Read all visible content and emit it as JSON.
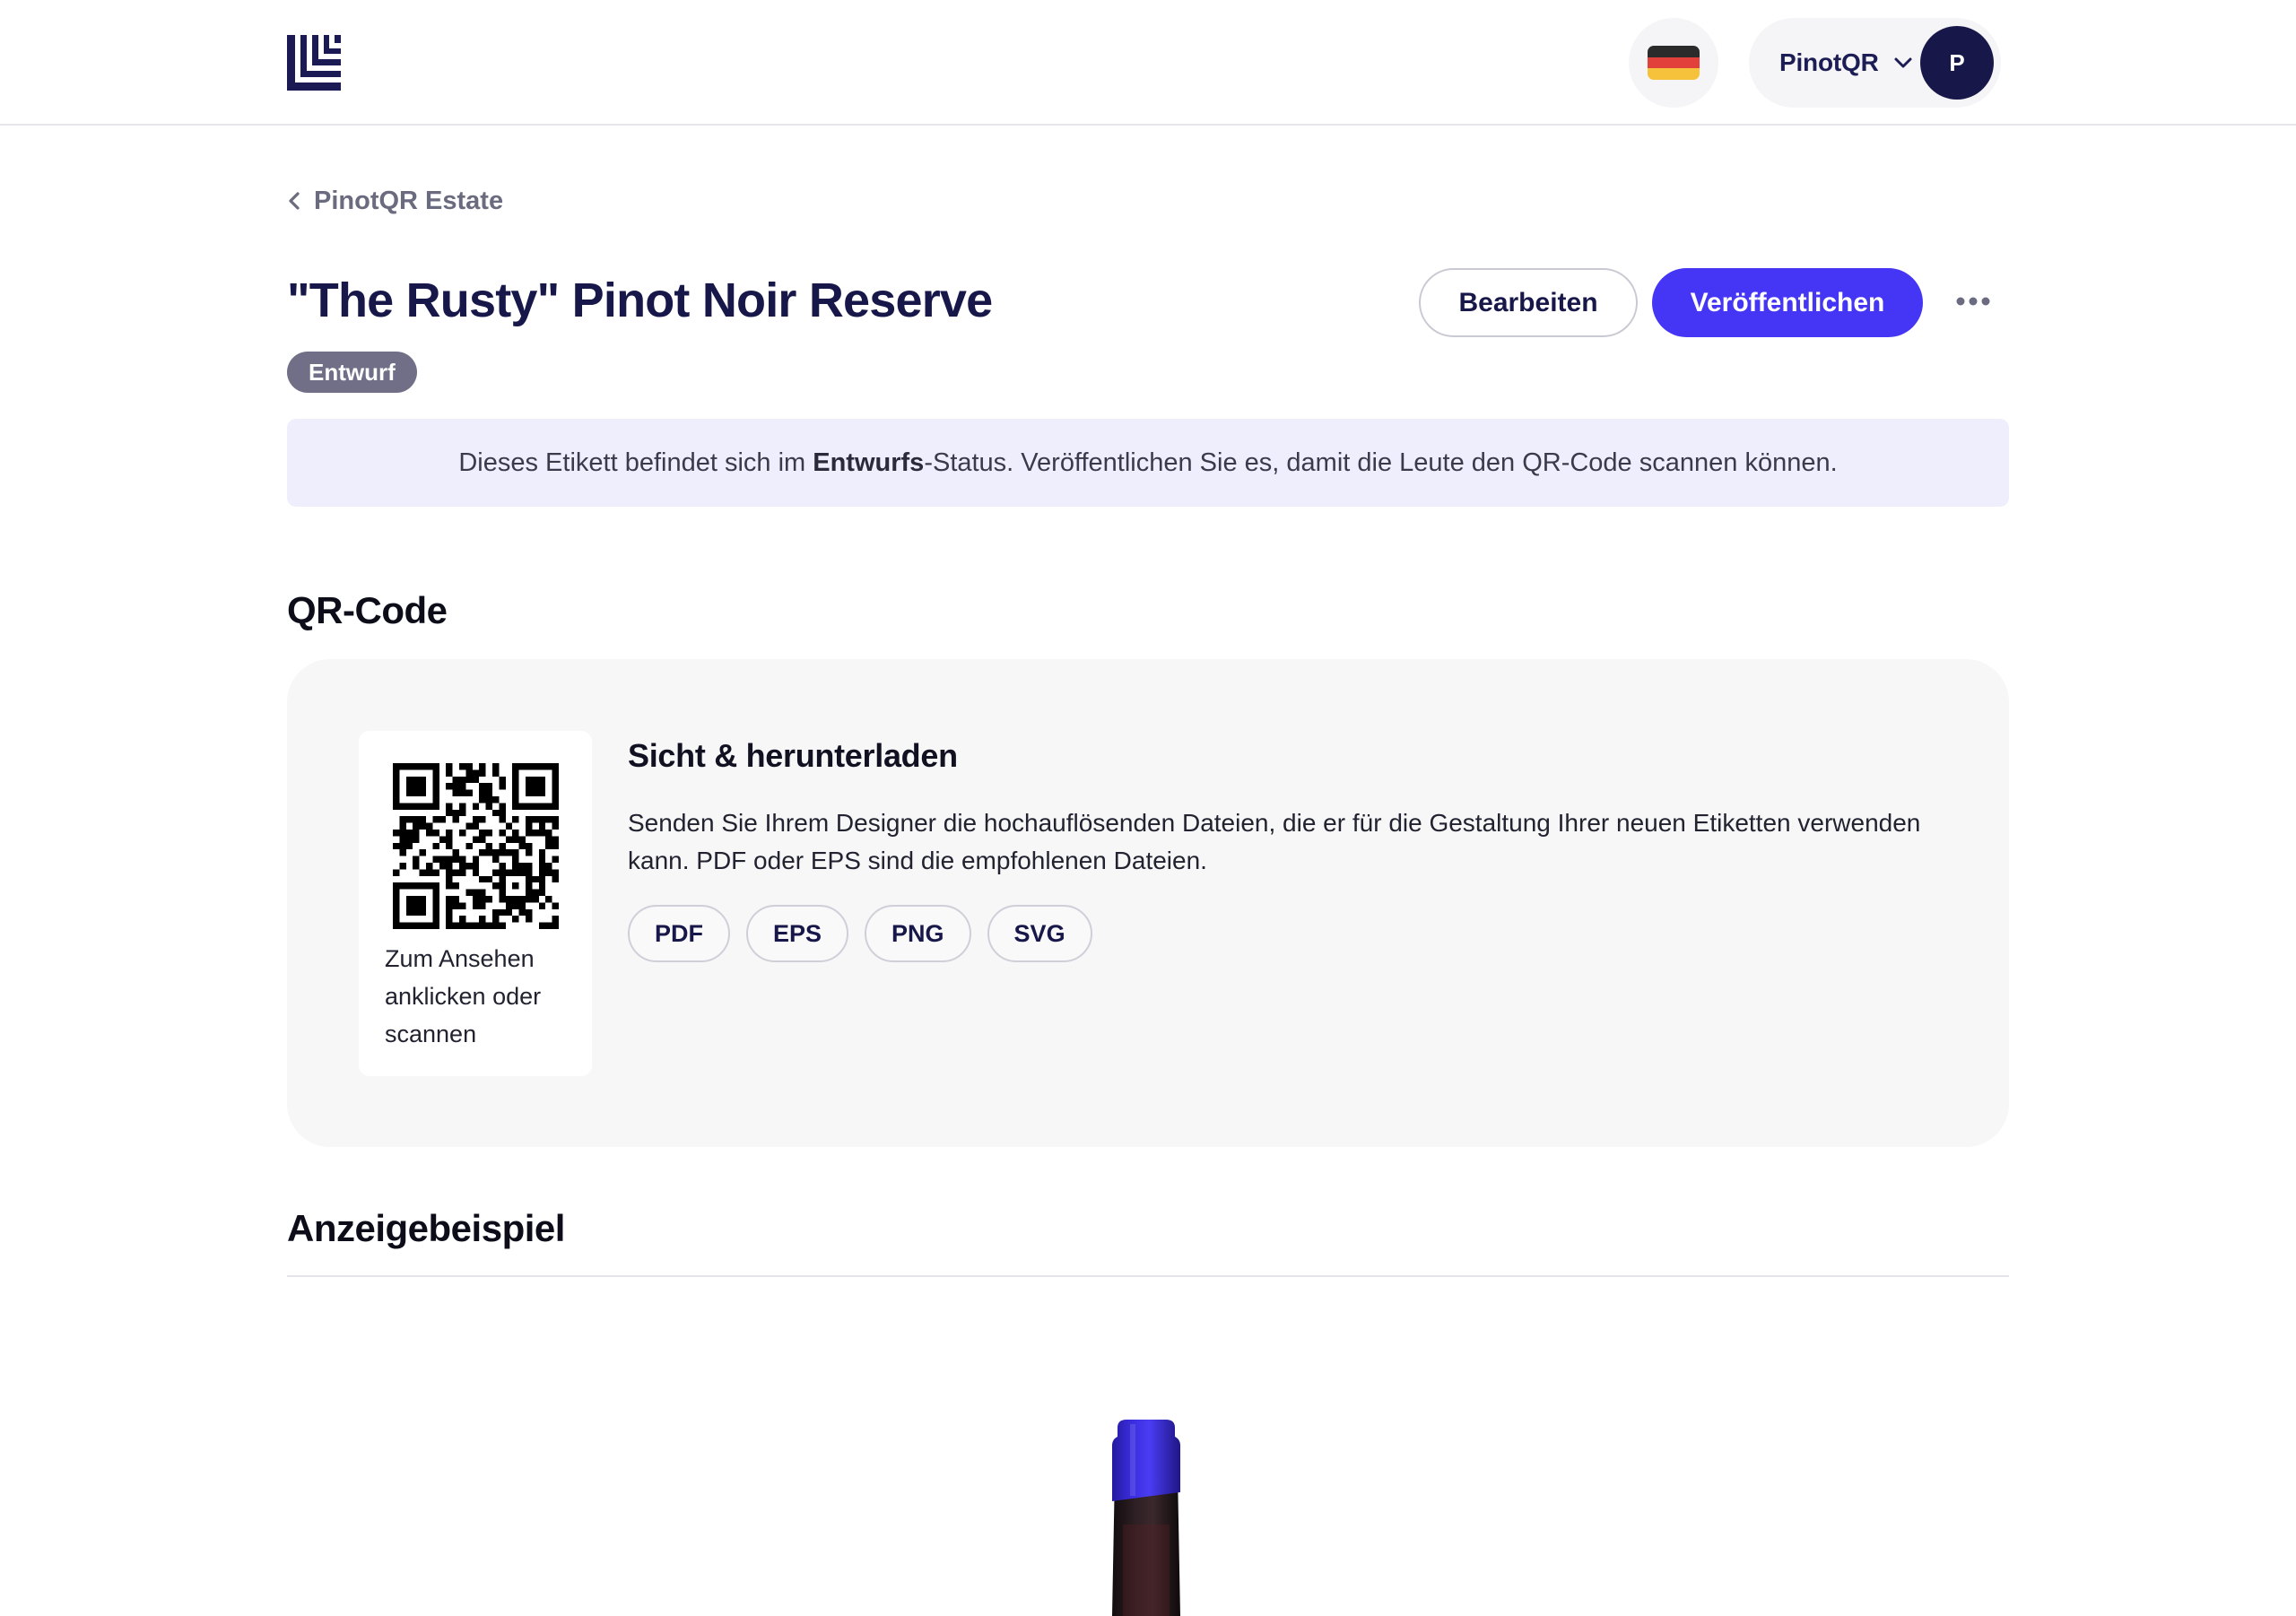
{
  "header": {
    "logo_icon": "stacked-l-logo-icon",
    "language_icon": "germany-flag-icon",
    "account_name": "PinotQR",
    "account_menu_icon": "chevron-down-icon",
    "avatar_initial": "P"
  },
  "breadcrumb": {
    "back_icon": "chevron-left-icon",
    "back_label": "PinotQR Estate"
  },
  "label": {
    "title": "\"The Rusty\" Pinot Noir Reserve",
    "status_badge": "Entwurf",
    "edit_button": "Bearbeiten",
    "publish_button": "Veröffentlichen",
    "more_icon": "more-horizontal-icon"
  },
  "notice": {
    "text_before": "Dieses Etikett befindet sich im ",
    "text_bold": "Entwurfs",
    "text_after": "-Status. Veröffentlichen Sie es, damit die Leute den QR-Code scannen können."
  },
  "qr_section": {
    "heading": "QR-Code",
    "preview_caption": "Zum Ansehen anklicken oder scannen",
    "download_title": "Sicht & herunterladen",
    "download_description": "Senden Sie Ihrem Designer die hochauflösenden Dateien, die er für die Gestaltung Ihrer neuen Etiketten verwenden kann. PDF oder EPS sind die empfohlenen Dateien.",
    "formats": [
      "PDF",
      "EPS",
      "PNG",
      "SVG"
    ]
  },
  "preview_section": {
    "heading": "Anzeigebeispiel",
    "preview_image": "wine-bottle-image"
  },
  "colors": {
    "accent": "#4536f5",
    "navy": "#17174a",
    "badge_bg": "#706f87",
    "notice_bg": "#eeeefc",
    "card_bg": "#f7f7f8"
  }
}
